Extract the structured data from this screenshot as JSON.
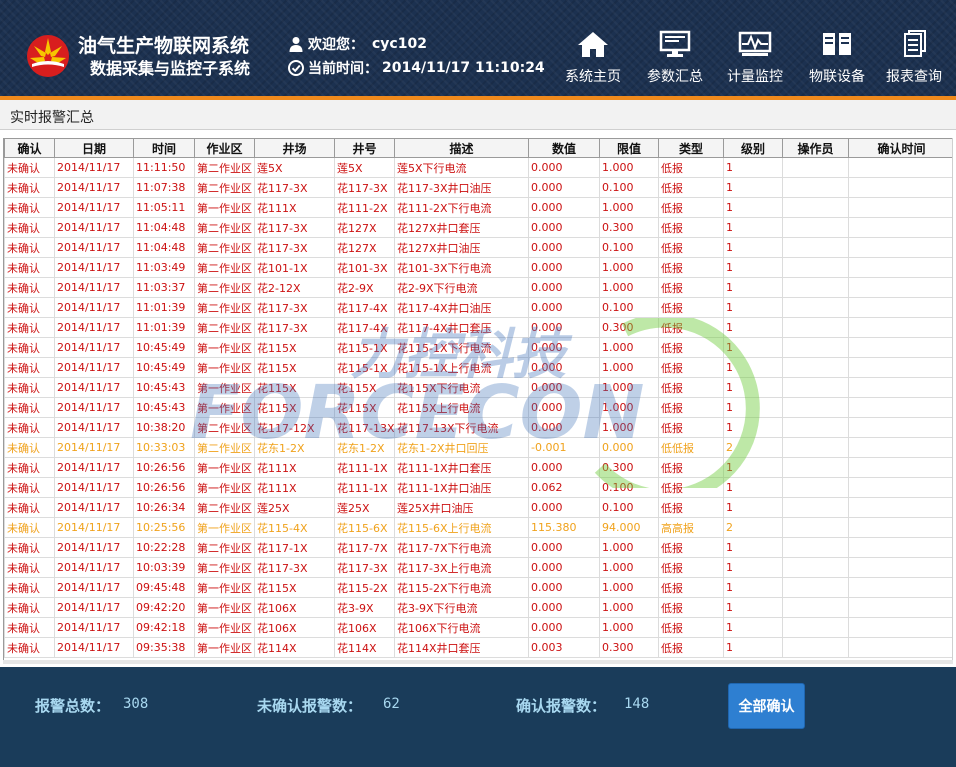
{
  "header": {
    "title": "油气生产物联网系统",
    "subtitle": "数据采集与监控子系统",
    "welcome_label": "欢迎您：",
    "username": "cyc102",
    "time_label": "当前时间：",
    "time_value": "2014/11/17 11:10:24",
    "nav": [
      {
        "label": "系统主页",
        "icon": "home-icon"
      },
      {
        "label": "参数汇总",
        "icon": "monitor-icon"
      },
      {
        "label": "计量监控",
        "icon": "waveform-icon"
      },
      {
        "label": "物联设备",
        "icon": "device-icon"
      },
      {
        "label": "报表查询",
        "icon": "report-icon"
      }
    ]
  },
  "section": {
    "title": "实时报警汇总"
  },
  "table": {
    "columns": [
      "确认",
      "日期",
      "时间",
      "作业区",
      "井场",
      "井号",
      "描述",
      "数值",
      "限值",
      "类型",
      "级别",
      "操作员",
      "确认时间"
    ],
    "rows": [
      [
        "未确认",
        "2014/11/17",
        "11:11:50",
        "第二作业区",
        "莲5X",
        "莲5X",
        "莲5X下行电流",
        "0.000",
        "1.000",
        "低报",
        "1",
        "",
        ""
      ],
      [
        "未确认",
        "2014/11/17",
        "11:07:38",
        "第二作业区",
        "花117-3X",
        "花117-3X",
        "花117-3X井口油压",
        "0.000",
        "0.100",
        "低报",
        "1",
        "",
        ""
      ],
      [
        "未确认",
        "2014/11/17",
        "11:05:11",
        "第一作业区",
        "花111X",
        "花111-2X",
        "花111-2X下行电流",
        "0.000",
        "1.000",
        "低报",
        "1",
        "",
        ""
      ],
      [
        "未确认",
        "2014/11/17",
        "11:04:48",
        "第二作业区",
        "花117-3X",
        "花127X",
        "花127X井口套压",
        "0.000",
        "0.300",
        "低报",
        "1",
        "",
        ""
      ],
      [
        "未确认",
        "2014/11/17",
        "11:04:48",
        "第二作业区",
        "花117-3X",
        "花127X",
        "花127X井口油压",
        "0.000",
        "0.100",
        "低报",
        "1",
        "",
        ""
      ],
      [
        "未确认",
        "2014/11/17",
        "11:03:49",
        "第二作业区",
        "花101-1X",
        "花101-3X",
        "花101-3X下行电流",
        "0.000",
        "1.000",
        "低报",
        "1",
        "",
        ""
      ],
      [
        "未确认",
        "2014/11/17",
        "11:03:37",
        "第二作业区",
        "花2-12X",
        "花2-9X",
        "花2-9X下行电流",
        "0.000",
        "1.000",
        "低报",
        "1",
        "",
        ""
      ],
      [
        "未确认",
        "2014/11/17",
        "11:01:39",
        "第二作业区",
        "花117-3X",
        "花117-4X",
        "花117-4X井口油压",
        "0.000",
        "0.100",
        "低报",
        "1",
        "",
        ""
      ],
      [
        "未确认",
        "2014/11/17",
        "11:01:39",
        "第二作业区",
        "花117-3X",
        "花117-4X",
        "花117-4X井口套压",
        "0.000",
        "0.300",
        "低报",
        "1",
        "",
        ""
      ],
      [
        "未确认",
        "2014/11/17",
        "10:45:49",
        "第一作业区",
        "花115X",
        "花115-1X",
        "花115-1X下行电流",
        "0.000",
        "1.000",
        "低报",
        "1",
        "",
        ""
      ],
      [
        "未确认",
        "2014/11/17",
        "10:45:49",
        "第一作业区",
        "花115X",
        "花115-1X",
        "花115-1X上行电流",
        "0.000",
        "1.000",
        "低报",
        "1",
        "",
        ""
      ],
      [
        "未确认",
        "2014/11/17",
        "10:45:43",
        "第一作业区",
        "花115X",
        "花115X",
        "花115X下行电流",
        "0.000",
        "1.000",
        "低报",
        "1",
        "",
        ""
      ],
      [
        "未确认",
        "2014/11/17",
        "10:45:43",
        "第一作业区",
        "花115X",
        "花115X",
        "花115X上行电流",
        "0.000",
        "1.000",
        "低报",
        "1",
        "",
        ""
      ],
      [
        "未确认",
        "2014/11/17",
        "10:38:20",
        "第二作业区",
        "花117-12X",
        "花117-13X",
        "花117-13X下行电流",
        "0.000",
        "1.000",
        "低报",
        "1",
        "",
        ""
      ],
      [
        "未确认",
        "2014/11/17",
        "10:33:03",
        "第二作业区",
        "花东1-2X",
        "花东1-2X",
        "花东1-2X井口回压",
        "-0.001",
        "0.000",
        "低低报",
        "2",
        "",
        ""
      ],
      [
        "未确认",
        "2014/11/17",
        "10:26:56",
        "第一作业区",
        "花111X",
        "花111-1X",
        "花111-1X井口套压",
        "0.000",
        "0.300",
        "低报",
        "1",
        "",
        ""
      ],
      [
        "未确认",
        "2014/11/17",
        "10:26:56",
        "第一作业区",
        "花111X",
        "花111-1X",
        "花111-1X井口油压",
        "0.062",
        "0.100",
        "低报",
        "1",
        "",
        ""
      ],
      [
        "未确认",
        "2014/11/17",
        "10:26:34",
        "第二作业区",
        "莲25X",
        "莲25X",
        "莲25X井口油压",
        "0.000",
        "0.100",
        "低报",
        "1",
        "",
        ""
      ],
      [
        "未确认",
        "2014/11/17",
        "10:25:56",
        "第一作业区",
        "花115-4X",
        "花115-6X",
        "花115-6X上行电流",
        "115.380",
        "94.000",
        "高高报",
        "2",
        "",
        ""
      ],
      [
        "未确认",
        "2014/11/17",
        "10:22:28",
        "第二作业区",
        "花117-1X",
        "花117-7X",
        "花117-7X下行电流",
        "0.000",
        "1.000",
        "低报",
        "1",
        "",
        ""
      ],
      [
        "未确认",
        "2014/11/17",
        "10:03:39",
        "第二作业区",
        "花117-3X",
        "花117-3X",
        "花117-3X上行电流",
        "0.000",
        "1.000",
        "低报",
        "1",
        "",
        ""
      ],
      [
        "未确认",
        "2014/11/17",
        "09:45:48",
        "第一作业区",
        "花115X",
        "花115-2X",
        "花115-2X下行电流",
        "0.000",
        "1.000",
        "低报",
        "1",
        "",
        ""
      ],
      [
        "未确认",
        "2014/11/17",
        "09:42:20",
        "第一作业区",
        "花106X",
        "花3-9X",
        "花3-9X下行电流",
        "0.000",
        "1.000",
        "低报",
        "1",
        "",
        ""
      ],
      [
        "未确认",
        "2014/11/17",
        "09:42:18",
        "第一作业区",
        "花106X",
        "花106X",
        "花106X下行电流",
        "0.000",
        "1.000",
        "低报",
        "1",
        "",
        ""
      ],
      [
        "未确认",
        "2014/11/17",
        "09:35:38",
        "第一作业区",
        "花114X",
        "花114X",
        "花114X井口套压",
        "0.003",
        "0.300",
        "低报",
        "1",
        "",
        ""
      ]
    ]
  },
  "watermark": {
    "text": "FORCECON",
    "text_cn": "力控科技"
  },
  "footer": {
    "total_label": "报警总数：",
    "total_value": "308",
    "unconfirmed_label": "未确认报警数：",
    "unconfirmed_value": "62",
    "confirmed_label": "确认报警数：",
    "confirmed_value": "148",
    "confirm_all_label": "全部确认"
  },
  "colors": {
    "header_bg": "#1c3150",
    "accent_orange": "#f08a1c",
    "level1_red": "#cc1111",
    "level2_orange": "#f0a21c",
    "footer_bg": "#1a3c5a",
    "stat_text": "#a8d8f0",
    "button_blue": "#2e7fd1"
  }
}
